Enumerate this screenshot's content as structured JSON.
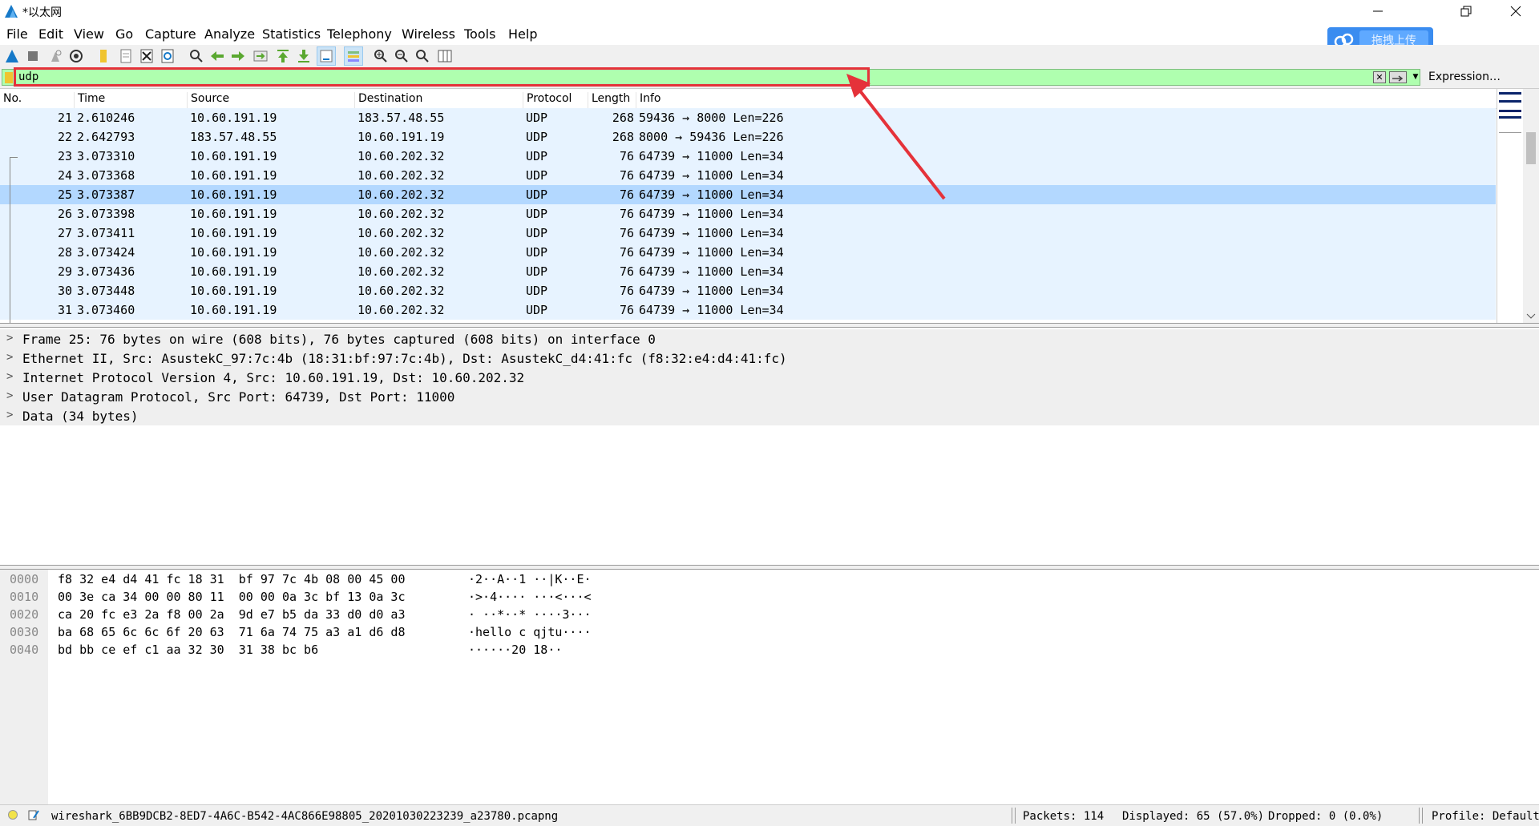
{
  "window": {
    "title": "*以太网"
  },
  "menu": [
    "File",
    "Edit",
    "View",
    "Go",
    "Capture",
    "Analyze",
    "Statistics",
    "Telephony",
    "Wireless",
    "Tools",
    "Help"
  ],
  "upload_button": {
    "label": "拖拽上传"
  },
  "filter": {
    "value": "udp",
    "expression_label": "Expression…"
  },
  "packet_columns": [
    "No.",
    "Time",
    "Source",
    "Destination",
    "Protocol",
    "Length",
    "Info"
  ],
  "packets": [
    {
      "no": "21",
      "time": "2.610246",
      "src": "10.60.191.19",
      "dst": "183.57.48.55",
      "proto": "UDP",
      "len": "268",
      "info": "59436 → 8000 Len=226"
    },
    {
      "no": "22",
      "time": "2.642793",
      "src": "183.57.48.55",
      "dst": "10.60.191.19",
      "proto": "UDP",
      "len": "268",
      "info": "8000 → 59436 Len=226"
    },
    {
      "no": "23",
      "time": "3.073310",
      "src": "10.60.191.19",
      "dst": "10.60.202.32",
      "proto": "UDP",
      "len": "76",
      "info": "64739 → 11000 Len=34"
    },
    {
      "no": "24",
      "time": "3.073368",
      "src": "10.60.191.19",
      "dst": "10.60.202.32",
      "proto": "UDP",
      "len": "76",
      "info": "64739 → 11000 Len=34"
    },
    {
      "no": "25",
      "time": "3.073387",
      "src": "10.60.191.19",
      "dst": "10.60.202.32",
      "proto": "UDP",
      "len": "76",
      "info": "64739 → 11000 Len=34"
    },
    {
      "no": "26",
      "time": "3.073398",
      "src": "10.60.191.19",
      "dst": "10.60.202.32",
      "proto": "UDP",
      "len": "76",
      "info": "64739 → 11000 Len=34"
    },
    {
      "no": "27",
      "time": "3.073411",
      "src": "10.60.191.19",
      "dst": "10.60.202.32",
      "proto": "UDP",
      "len": "76",
      "info": "64739 → 11000 Len=34"
    },
    {
      "no": "28",
      "time": "3.073424",
      "src": "10.60.191.19",
      "dst": "10.60.202.32",
      "proto": "UDP",
      "len": "76",
      "info": "64739 → 11000 Len=34"
    },
    {
      "no": "29",
      "time": "3.073436",
      "src": "10.60.191.19",
      "dst": "10.60.202.32",
      "proto": "UDP",
      "len": "76",
      "info": "64739 → 11000 Len=34"
    },
    {
      "no": "30",
      "time": "3.073448",
      "src": "10.60.191.19",
      "dst": "10.60.202.32",
      "proto": "UDP",
      "len": "76",
      "info": "64739 → 11000 Len=34"
    },
    {
      "no": "31",
      "time": "3.073460",
      "src": "10.60.191.19",
      "dst": "10.60.202.32",
      "proto": "UDP",
      "len": "76",
      "info": "64739 → 11000 Len=34"
    }
  ],
  "selected_packet": "25",
  "details": [
    "Frame 25: 76 bytes on wire (608 bits), 76 bytes captured (608 bits) on interface 0",
    "Ethernet II, Src: AsustekC_97:7c:4b (18:31:bf:97:7c:4b), Dst: AsustekC_d4:41:fc (f8:32:e4:d4:41:fc)",
    "Internet Protocol Version 4, Src: 10.60.191.19, Dst: 10.60.202.32",
    "User Datagram Protocol, Src Port: 64739, Dst Port: 11000",
    "Data (34 bytes)"
  ],
  "bytes": [
    {
      "offset": "0000",
      "hex": "f8 32 e4 d4 41 fc 18 31  bf 97 7c 4b 08 00 45 00",
      "ascii": "·2··A··1 ··|K··E·"
    },
    {
      "offset": "0010",
      "hex": "00 3e ca 34 00 00 80 11  00 00 0a 3c bf 13 0a 3c",
      "ascii": "·>·4···· ···<···<"
    },
    {
      "offset": "0020",
      "hex": "ca 20 fc e3 2a f8 00 2a  9d e7 b5 da 33 d0 d0 a3",
      "ascii": "· ··*··* ····3···"
    },
    {
      "offset": "0030",
      "hex": "ba 68 65 6c 6c 6f 20 63  71 6a 74 75 a3 a1 d6 d8",
      "ascii": "·hello c qjtu····"
    },
    {
      "offset": "0040",
      "hex": "bd bb ce ef c1 aa 32 30  31 38 bc b6",
      "ascii": "······20 18··"
    }
  ],
  "status": {
    "file": "wireshark_6BB9DCB2-8ED7-4A6C-B542-4AC866E98805_20201030223239_a23780.pcapng",
    "packets": "Packets: 114",
    "displayed": "Displayed: 65 (57.0%)",
    "dropped": "Dropped: 0 (0.0%)",
    "profile": "Profile: Default"
  },
  "colors": {
    "filter_ok": "#afffaf",
    "row_bg": "#e7f3ff",
    "row_selected": "#b3d8ff",
    "annotation": "#e5323a"
  }
}
